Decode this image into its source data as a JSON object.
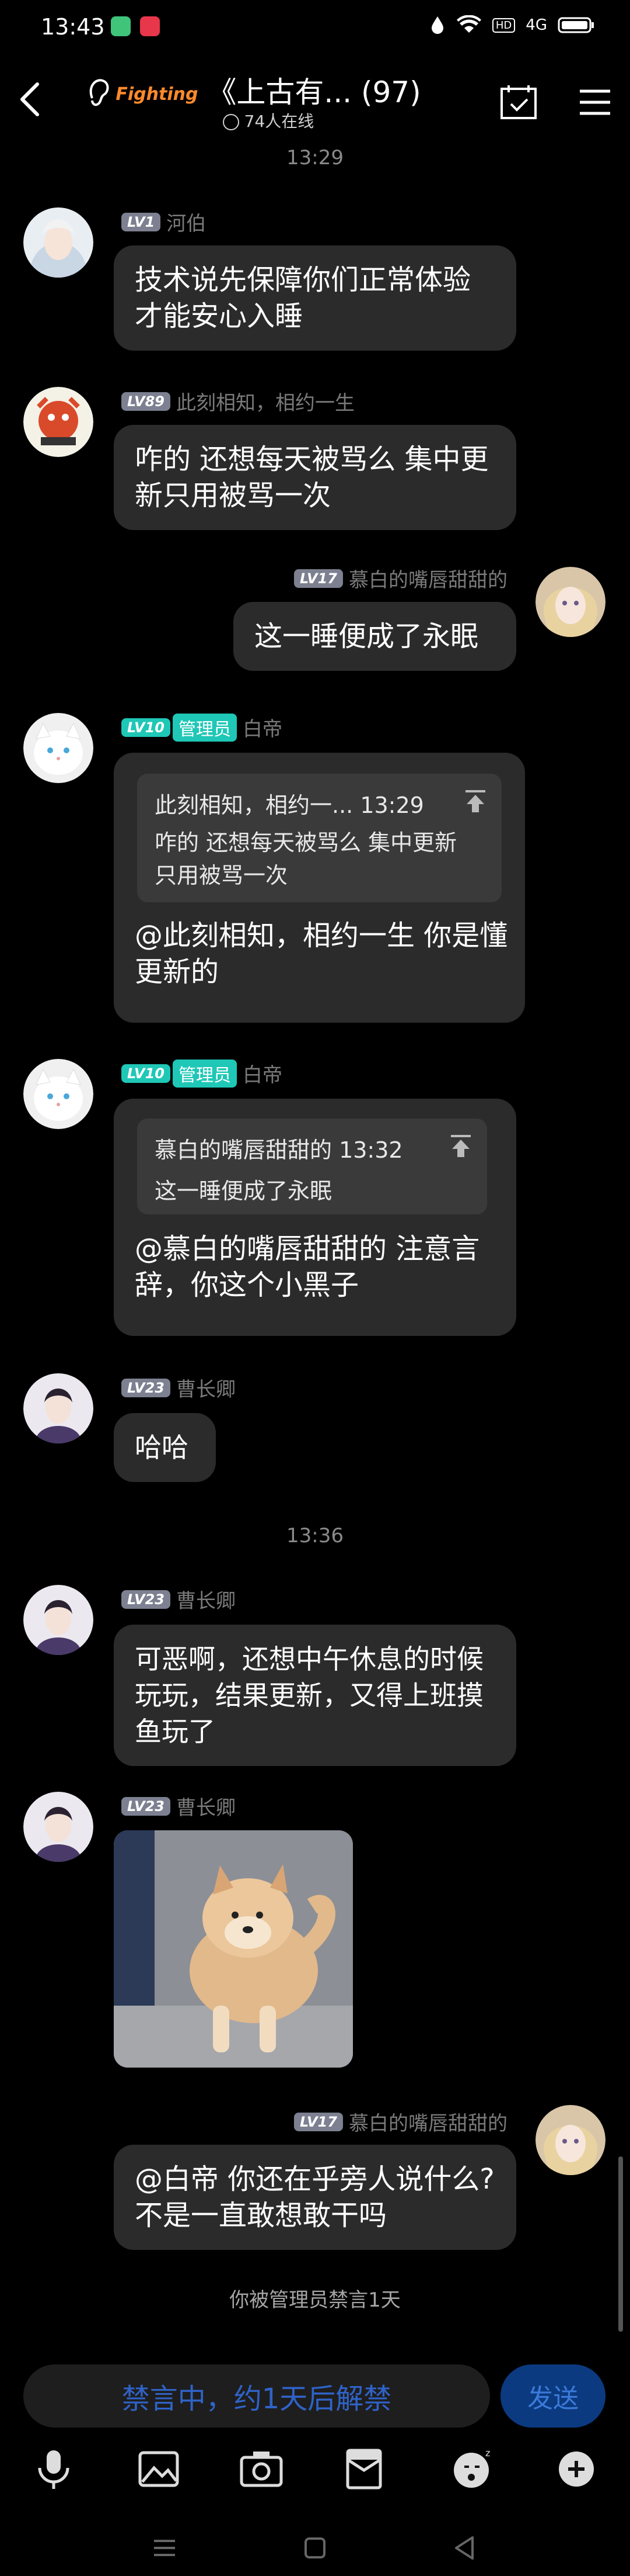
{
  "status_bar": {
    "time": "13:43",
    "battery_icon": "battery-icon",
    "wifi_icon": "wifi-icon",
    "signal_text": "4G"
  },
  "header": {
    "title": "《上古有... (97)",
    "online": "74人在线",
    "logo_text": "Fighting"
  },
  "messages": [
    {
      "time": "13:29"
    },
    {
      "level": "LV1",
      "name": "河伯",
      "text": "技术说先保障你们正常体验才能安心入睡"
    },
    {
      "level": "LV89",
      "name": "此刻相知，相约一生",
      "text": "咋的 还想每天被骂么  集中更新只用被骂一次"
    },
    {
      "level": "LV17",
      "name": "慕白的嘴唇甜甜的",
      "text": "这一睡便成了永眠"
    },
    {
      "level": "LV10",
      "role": "管理员",
      "name": "白帝",
      "quote": {
        "author": "此刻相知，相约一... 13:29",
        "text": "咋的 还想每天被骂么  集中更新只用被骂一次"
      },
      "text": "@此刻相知，相约一生 你是懂更新的"
    },
    {
      "level": "LV10",
      "role": "管理员",
      "name": "白帝",
      "quote": {
        "author": "慕白的嘴唇甜甜的 13:32",
        "text": "这一睡便成了永眠"
      },
      "text": "@慕白的嘴唇甜甜的 注意言辞，你这个小黑子"
    },
    {
      "level": "LV23",
      "name": "曹长卿",
      "text": "哈哈"
    },
    {
      "time": "13:36"
    },
    {
      "level": "LV23",
      "name": "曹长卿",
      "text": "可恶啊，还想中午休息的时候玩玩，结果更新，又得上班摸鱼玩了"
    },
    {
      "level": "LV23",
      "name": "曹长卿",
      "image": "dog-photo"
    },
    {
      "level": "LV17",
      "name": "慕白的嘴唇甜甜的",
      "text": "@白帝 你还在乎旁人说什么?不是一直敢想敢干吗"
    }
  ],
  "notice": "你被管理员禁言1天",
  "input": {
    "placeholder": "禁言中，约1天后解禁",
    "send_label": "发送"
  },
  "colors": {
    "bubble": "#2b2b2b",
    "accent_teal": "#1fc7b6",
    "send": "#0b3a80"
  }
}
